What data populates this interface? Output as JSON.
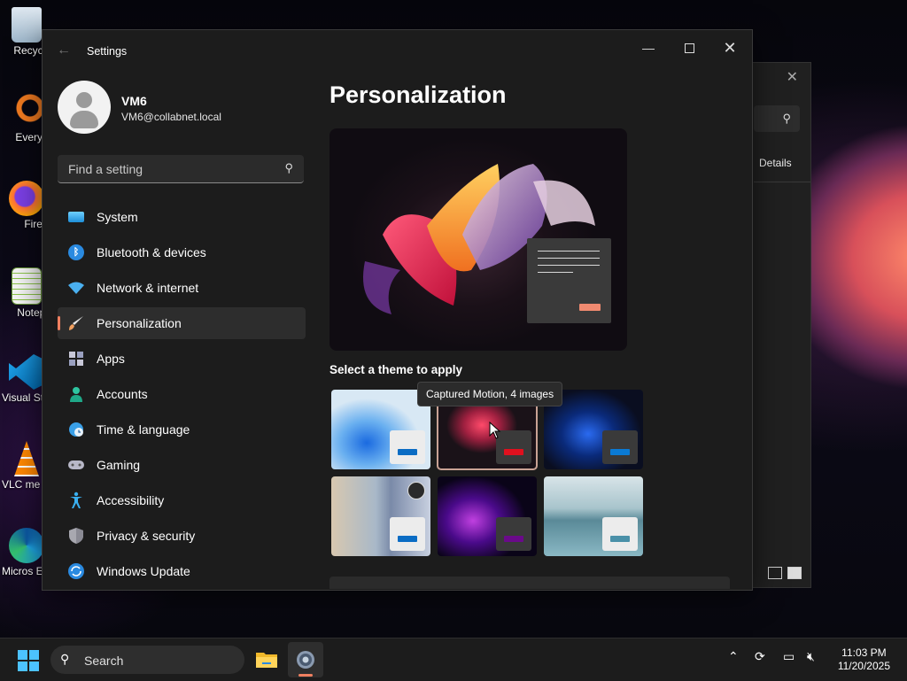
{
  "desktop_icons": [
    {
      "label": "Recycle",
      "icon": "recycle-bin-icon"
    },
    {
      "label": "Everyth",
      "icon": "everything-search-icon"
    },
    {
      "label": "Firefo",
      "icon": "firefox-icon"
    },
    {
      "label": "Notepa",
      "icon": "notepad-icon"
    },
    {
      "label": "Visual St Cod",
      "icon": "vscode-icon"
    },
    {
      "label": "VLC me playe",
      "icon": "vlc-icon"
    },
    {
      "label": "Micros Edge",
      "icon": "edge-icon"
    }
  ],
  "background_window": {
    "details_label": "Details"
  },
  "settings": {
    "app_title": "Settings",
    "user": {
      "name": "VM6",
      "email": "VM6@collabnet.local"
    },
    "search_placeholder": "Find a setting",
    "nav": [
      {
        "label": "System",
        "icon": "system-icon",
        "active": false
      },
      {
        "label": "Bluetooth & devices",
        "icon": "bluetooth-icon",
        "active": false
      },
      {
        "label": "Network & internet",
        "icon": "wifi-icon",
        "active": false
      },
      {
        "label": "Personalization",
        "icon": "brush-icon",
        "active": true
      },
      {
        "label": "Apps",
        "icon": "apps-icon",
        "active": false
      },
      {
        "label": "Accounts",
        "icon": "accounts-icon",
        "active": false
      },
      {
        "label": "Time & language",
        "icon": "globe-clock-icon",
        "active": false
      },
      {
        "label": "Gaming",
        "icon": "gamepad-icon",
        "active": false
      },
      {
        "label": "Accessibility",
        "icon": "accessibility-icon",
        "active": false
      },
      {
        "label": "Privacy & security",
        "icon": "shield-icon",
        "active": false
      },
      {
        "label": "Windows Update",
        "icon": "update-icon",
        "active": false
      }
    ],
    "page_title": "Personalization",
    "themes_label": "Select a theme to apply",
    "tooltip": "Captured Motion, 4 images",
    "themes": [
      {
        "name": "windows-light",
        "accent": "#0a6cc4",
        "selected": false
      },
      {
        "name": "captured-motion",
        "accent": "#e0101e",
        "selected": true
      },
      {
        "name": "windows-dark",
        "accent": "#0a7ad4",
        "selected": false
      },
      {
        "name": "glow",
        "accent": "#0a6cc4",
        "selected": false
      },
      {
        "name": "sunrise",
        "accent": "#6a0a8a",
        "selected": false
      },
      {
        "name": "flow",
        "accent": "#4a90a8",
        "selected": false
      }
    ]
  },
  "taskbar": {
    "search_placeholder": "Search",
    "apps": [
      {
        "name": "file-explorer",
        "icon": "folder-icon"
      },
      {
        "name": "settings",
        "icon": "settings-gear-icon",
        "active": true
      }
    ],
    "clock": {
      "time": "11:03 PM",
      "date": "11/20/2025"
    }
  },
  "colors": {
    "accent": "#f08060",
    "windows_blue": "#4cc2ff"
  }
}
